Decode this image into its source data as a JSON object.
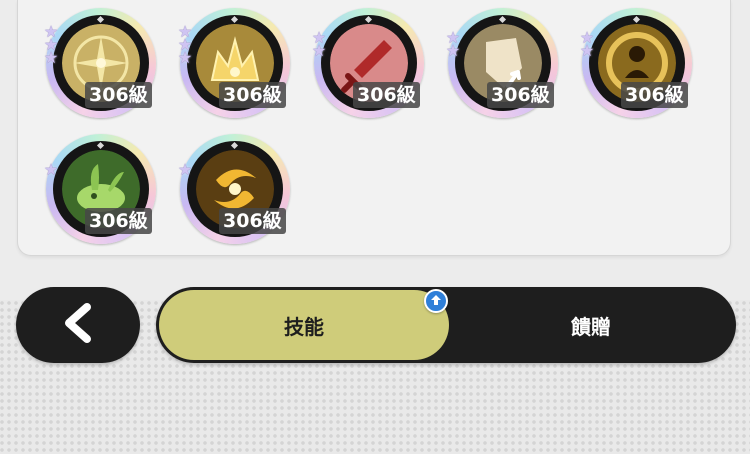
{
  "skills": [
    {
      "level": "306級",
      "stars": 3,
      "icon": "golden-snowflake-skill-icon",
      "orb_color": "#c9b166",
      "accent": "#f3e6a6"
    },
    {
      "level": "306級",
      "stars": 3,
      "icon": "golden-crown-burst-skill-icon",
      "orb_color": "#a88a3a",
      "accent": "#f5d56a"
    },
    {
      "level": "306級",
      "stars": 2,
      "icon": "red-sword-skill-icon",
      "orb_color": "#d98a8a",
      "accent": "#b02a2a"
    },
    {
      "level": "306級",
      "stars": 2,
      "icon": "shield-arrow-skill-icon",
      "orb_color": "#9a8a64",
      "accent": "#efe3c8"
    },
    {
      "level": "306級",
      "stars": 2,
      "icon": "golden-portal-figure-skill-icon",
      "orb_color": "#8a6a1e",
      "accent": "#e7c25a"
    },
    {
      "level": "306級",
      "stars": 1,
      "icon": "green-plant-creature-skill-icon",
      "orb_color": "#3e6b2a",
      "accent": "#a7d86a"
    },
    {
      "level": "306級",
      "stars": 1,
      "icon": "golden-swirl-skill-icon",
      "orb_color": "#5a3e12",
      "accent": "#f1b732"
    }
  ],
  "tabs": {
    "back_icon": "chevron-left-icon",
    "active_label": "技能",
    "inactive_label": "饋贈",
    "badge_icon": "arrow-up-icon"
  },
  "colors": {
    "tab_active": "#cfcc7a",
    "tab_bar": "#1e1e1e",
    "badge": "#2f7fd8"
  }
}
